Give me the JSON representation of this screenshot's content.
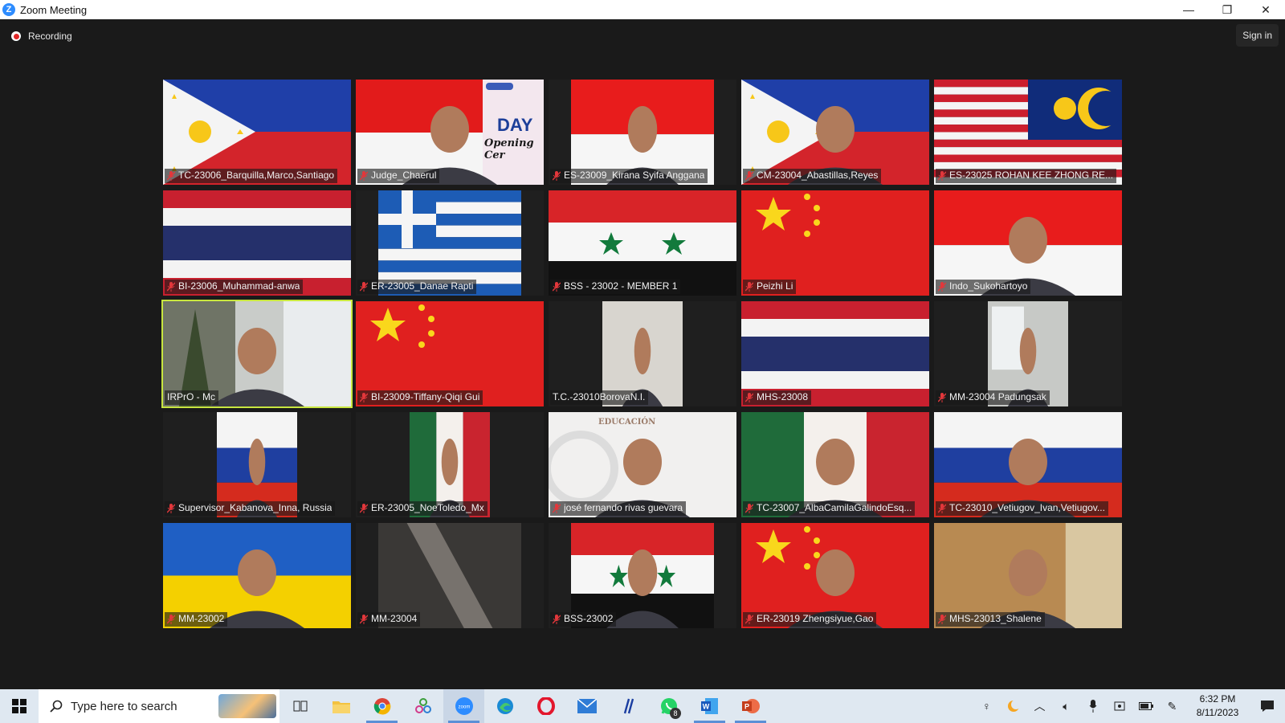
{
  "window": {
    "title": "Zoom Meeting",
    "minimize_glyph": "—",
    "restore_glyph": "❐",
    "close_glyph": "✕"
  },
  "toolbar": {
    "recording_label": "Recording",
    "signin_label": "Sign in"
  },
  "colors": {
    "active_speaker_border": "#c8e640",
    "recording_red": "#e02828",
    "zoom_blue": "#2d8cff"
  },
  "tiles": [
    {
      "name": "TC-23006_Barquilla,Marco,Santiago",
      "muted": true,
      "bg": "philippines",
      "width": "full",
      "person": false
    },
    {
      "name": "Judge_Chaerul",
      "muted": true,
      "bg": "indonesia_poster",
      "width": "full",
      "person": true
    },
    {
      "name": "ES-23009_Kirana Syifa Anggana",
      "muted": true,
      "bg": "indonesia",
      "width": "mid",
      "person": true
    },
    {
      "name": "CM-23004_Abastillas,Reyes",
      "muted": true,
      "bg": "philippines",
      "width": "full",
      "person": true
    },
    {
      "name": "ES-23025 ROHAN KEE ZHONG RE...",
      "muted": true,
      "bg": "malaysia",
      "width": "full",
      "person": false
    },
    {
      "name": "BI-23006_Muhammad-anwa",
      "muted": true,
      "bg": "thailand",
      "width": "full",
      "person": false
    },
    {
      "name": "ER-23005_Danae Rapti",
      "muted": true,
      "bg": "greece",
      "width": "mid",
      "person": false
    },
    {
      "name": "BSS - 23002 - MEMBER 1",
      "muted": true,
      "bg": "syria",
      "width": "full",
      "person": false
    },
    {
      "name": "Peizhi Li",
      "muted": true,
      "bg": "china",
      "width": "full",
      "person": false
    },
    {
      "name": "Indo_Sukohartoyo",
      "muted": true,
      "bg": "indonesia",
      "width": "full",
      "person": true
    },
    {
      "name": "IRPrO - Mc",
      "muted": false,
      "bg": "office",
      "width": "full",
      "person": true,
      "active": true
    },
    {
      "name": "BI-23009-Tiffany-Qiqi Gui",
      "muted": true,
      "bg": "china",
      "width": "full",
      "person": false
    },
    {
      "name": "T.C.-23010BorovaN.I.",
      "muted": false,
      "bg": "room_light",
      "width": "narrow",
      "person": true
    },
    {
      "name": "MHS-23008",
      "muted": true,
      "bg": "thailand",
      "width": "full",
      "person": false
    },
    {
      "name": "MM-23004 Padungsak",
      "muted": true,
      "bg": "window_room",
      "width": "narrow",
      "person": true
    },
    {
      "name": "Supervisor_Kabanova_Inna, Russia",
      "muted": true,
      "bg": "russia",
      "width": "narrow",
      "person": true
    },
    {
      "name": "ER-23005_NoeToledo_Mx",
      "muted": true,
      "bg": "mexico",
      "width": "narrow",
      "person": true
    },
    {
      "name": "josé fernando rivas guevara",
      "muted": true,
      "bg": "education_logo",
      "width": "full",
      "person": true
    },
    {
      "name": "TC-23007_AlbaCamilaGalindoEsq...",
      "muted": true,
      "bg": "mexico",
      "width": "full",
      "person": true
    },
    {
      "name": "TC-23010_Vetiugov_Ivan,Vetiugov...",
      "muted": true,
      "bg": "russia",
      "width": "full",
      "person": true
    },
    {
      "name": "MM-23002",
      "muted": true,
      "bg": "ukraine",
      "width": "full",
      "person": true
    },
    {
      "name": "MM-23004",
      "muted": true,
      "bg": "dark_room",
      "width": "mid",
      "person": false
    },
    {
      "name": "BSS-23002",
      "muted": true,
      "bg": "syria",
      "width": "mid",
      "person": true
    },
    {
      "name": "ER-23019 Zhengsiyue,Gao",
      "muted": true,
      "bg": "china",
      "width": "full",
      "person": true
    },
    {
      "name": "MHS-23013_Shalene",
      "muted": true,
      "bg": "wood_room",
      "width": "full",
      "person": true
    }
  ],
  "poster": {
    "title": "DAY",
    "subtitle": "Opening Cer"
  },
  "education_text": "EDUCACIÓN",
  "taskbar": {
    "search_placeholder": "Type here to search",
    "apps": [
      {
        "icon": "task-view-icon",
        "open": false
      },
      {
        "icon": "file-explorer-icon",
        "open": false
      },
      {
        "icon": "chrome-icon",
        "open": true
      },
      {
        "icon": "pinned-app-icon",
        "open": false
      },
      {
        "icon": "zoom-icon",
        "open": true,
        "active": true
      },
      {
        "icon": "edge-icon",
        "open": false
      },
      {
        "icon": "opera-icon",
        "open": false
      },
      {
        "icon": "mail-icon",
        "open": false
      },
      {
        "icon": "slash-app-icon",
        "open": false
      },
      {
        "icon": "whatsapp-icon",
        "open": false,
        "badge": "8"
      },
      {
        "icon": "word-icon",
        "open": true
      },
      {
        "icon": "powerpoint-icon",
        "open": true
      }
    ],
    "time": "6:32 PM",
    "date": "8/11/2023"
  }
}
